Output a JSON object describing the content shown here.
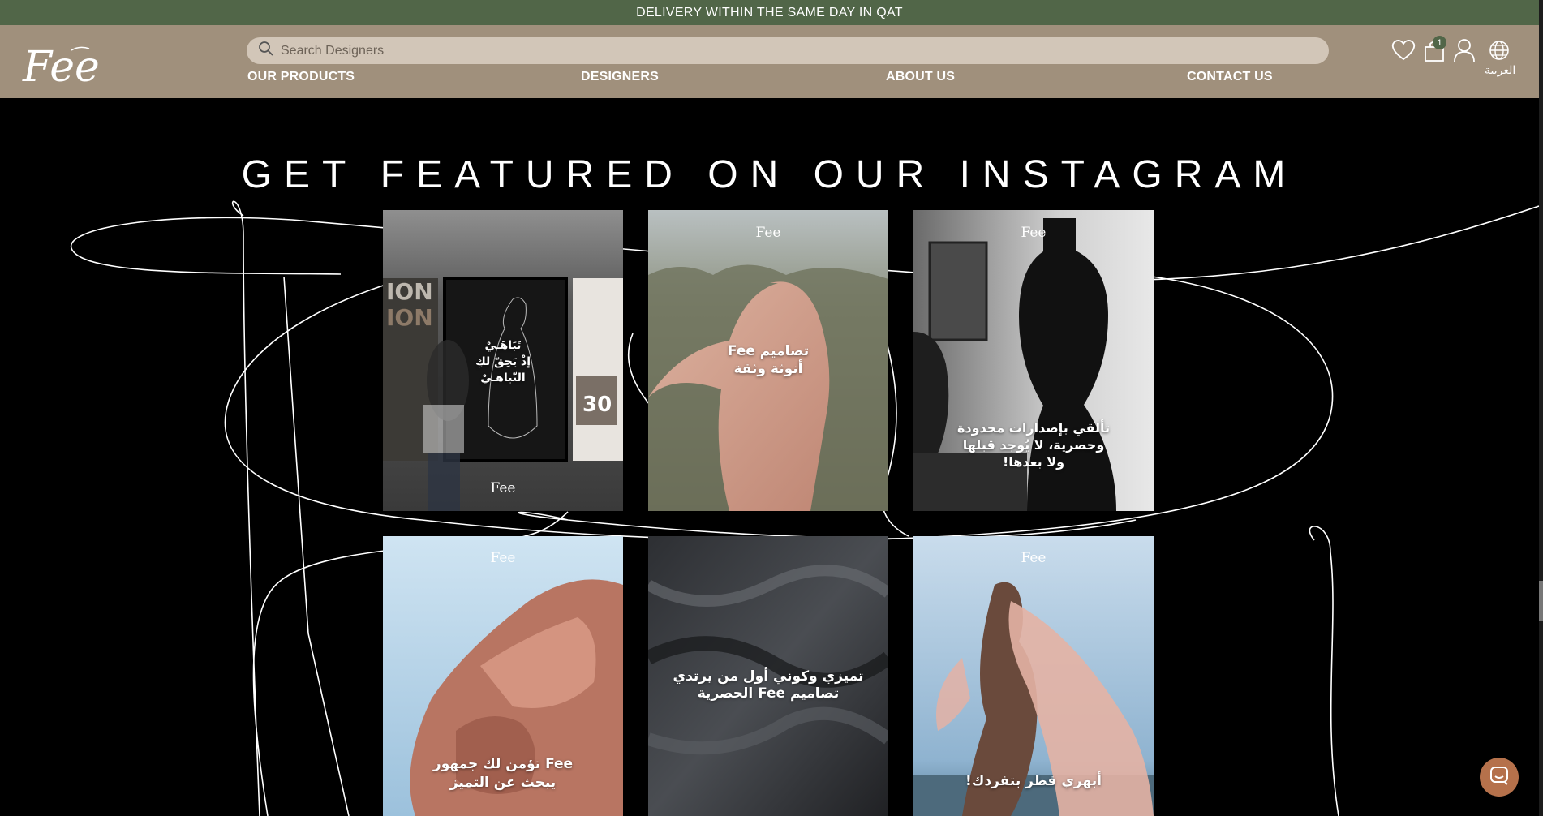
{
  "announcement": "DELIVERY WITHIN THE SAME DAY IN QAT",
  "brand": {
    "logo_text": "Fee"
  },
  "search": {
    "placeholder": "Search Designers"
  },
  "nav": [
    {
      "label": "OUR PRODUCTS"
    },
    {
      "label": "DESIGNERS"
    },
    {
      "label": "ABOUT US"
    },
    {
      "label": "CONTACT US"
    }
  ],
  "header_icons": {
    "wishlist": "heart-icon",
    "cart": "shopping-bag-icon",
    "cart_count": "1",
    "account": "user-icon",
    "language": "globe-icon",
    "language_label": "العربية"
  },
  "section": {
    "heading": "GET FEATURED ON OUR INSTAGRAM"
  },
  "posts": [
    {
      "caption": "تَبَاهَـيْ\nإذْ يَحِقّ لكِ\nالتّباهـيْ",
      "logo": "Fee"
    },
    {
      "caption": "تصاميم Fee\nأنوثة وثقة",
      "logo": "Fee"
    },
    {
      "caption": "تألقي بإصدارات محدودة\nوحصرية، لا يُوجد قبلها\nولا بعدها!",
      "logo": "Fee"
    },
    {
      "caption": "Fee تؤمن لك جمهور\nيبحث عن التميز",
      "logo": "Fee"
    },
    {
      "caption": "تميزي وكوني أول من يرتدي\nتصاميم Fee الحصرية",
      "logo": "Fee"
    },
    {
      "caption": "أبهري قطر بتفردك!",
      "logo": "Fee"
    }
  ],
  "colors": {
    "announcement_bg": "#516648",
    "header_bg": "#a0907c",
    "search_bg": "#d2c6b8",
    "page_bg": "#000000",
    "chat_button": "#b5714b"
  },
  "chat": {
    "icon": "chat-icon"
  }
}
